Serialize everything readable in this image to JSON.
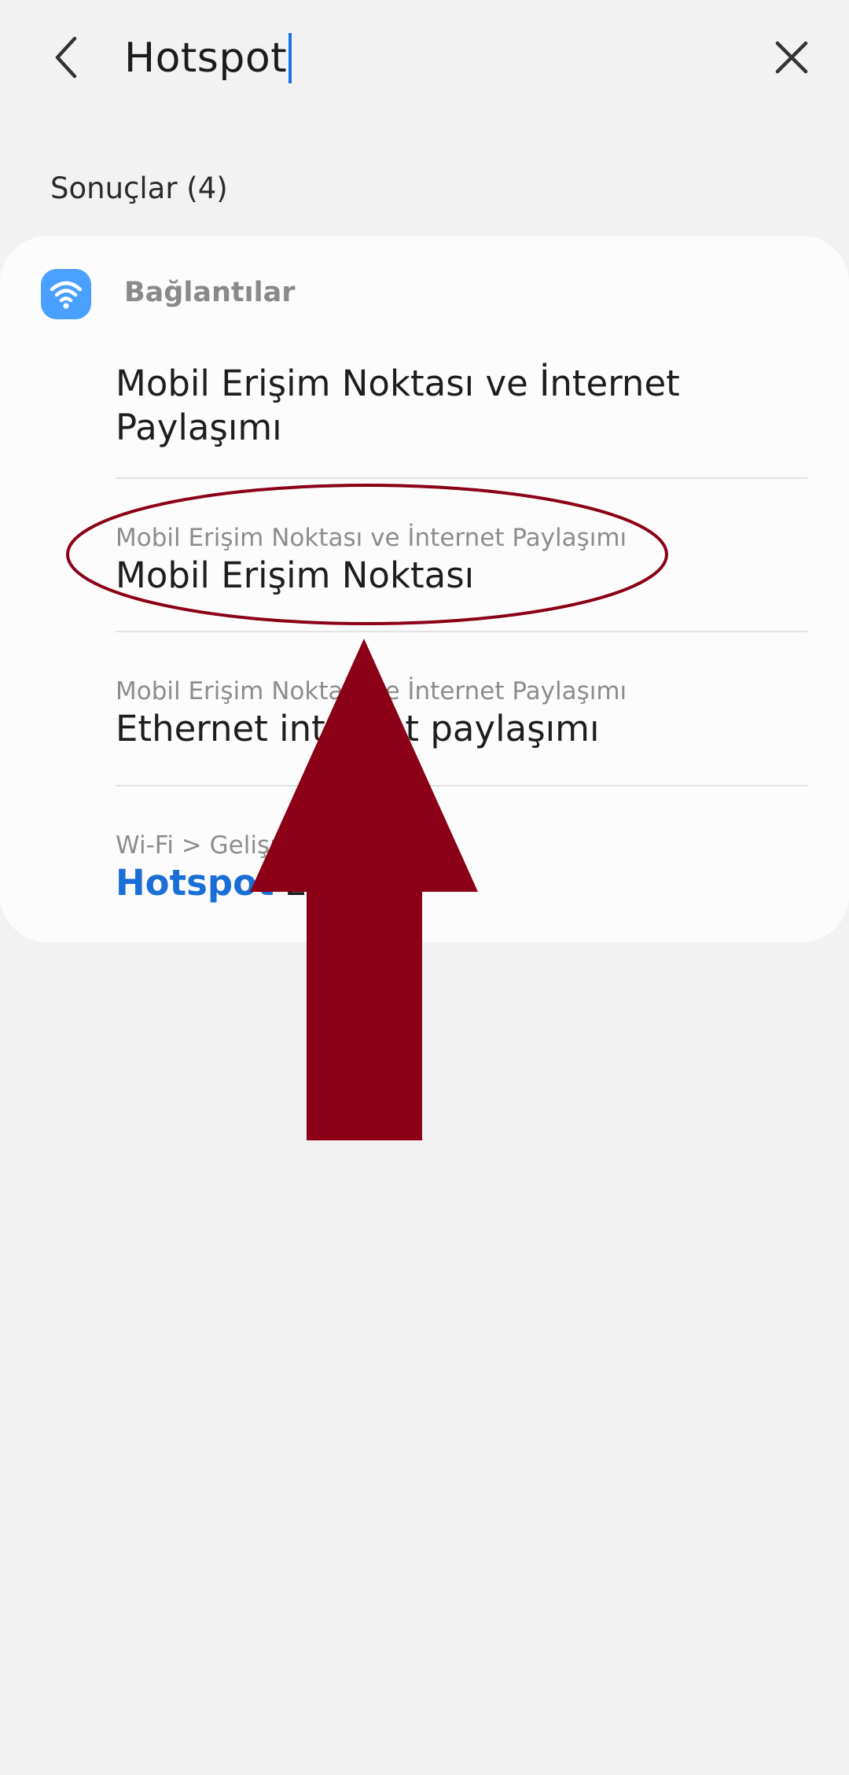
{
  "search": {
    "query": "Hotspot",
    "back_icon": "chevron-left-icon",
    "clear_icon": "close-icon"
  },
  "results": {
    "count_label": "Sonuçlar (4)"
  },
  "category": {
    "icon": "wifi-icon",
    "icon_color": "#4aa0ff",
    "label": "Bağlantılar"
  },
  "items": [
    {
      "crumb": "",
      "title": "Mobil Erişim Noktası ve İnternet Paylaşımı"
    },
    {
      "crumb": "Mobil Erişim Noktası ve İnternet Paylaşımı",
      "title": "Mobil Erişim Noktası"
    },
    {
      "crumb": "Mobil Erişim Noktası ve İnternet Paylaşımı",
      "title": "Ethernet internet paylaşımı"
    },
    {
      "crumb": "Wi-Fi > Gelişmiş",
      "title_highlight": "Hotspot",
      "title_rest": " 2.0"
    }
  ],
  "annotation": {
    "color": "#8b0016"
  }
}
